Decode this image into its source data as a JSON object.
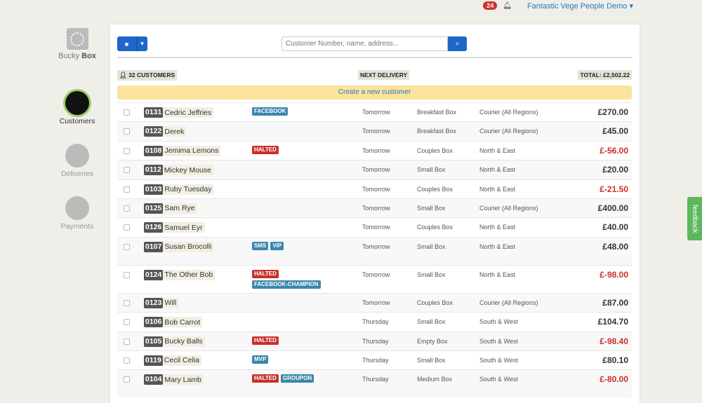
{
  "topbar": {
    "notifications": "24",
    "account": "Fantastic Vege People Demo ▾"
  },
  "sidebar": {
    "logo": {
      "a": "Bucky",
      "b": "Box"
    },
    "items": [
      {
        "label": "Customers"
      },
      {
        "label": "Deliveries"
      },
      {
        "label": "Payments"
      }
    ]
  },
  "toolbar": {
    "dropdown": "▾",
    "search_placeholder": "Customer Number, name, address...",
    "search_icon": "⌕"
  },
  "summary": {
    "customers": "32 CUSTOMERS",
    "next_delivery": "NEXT DELIVERY",
    "total": "TOTAL: £2,502.22"
  },
  "create_label": "Create a new customer",
  "feedback": "feedback",
  "customers": [
    {
      "num": "0131",
      "name": "Cedric Jeffries",
      "tags": [
        "FACEBOOK"
      ],
      "delivery": "Tomorrow",
      "box": "Breakfast Box",
      "route": "Courier (All Regions)",
      "amount": "£270.00"
    },
    {
      "num": "0122",
      "name": "Derek",
      "tags": [],
      "delivery": "Tomorrow",
      "box": "Breakfast Box",
      "route": "Courier (All Regions)",
      "amount": "£45.00"
    },
    {
      "num": "0108",
      "name": "Jemima Lemons",
      "tags": [
        "HALTED"
      ],
      "delivery": "Tomorrow",
      "box": "Couples Box",
      "route": "North & East",
      "amount": "£-56.00"
    },
    {
      "num": "0112",
      "name": "Mickey Mouse",
      "tags": [],
      "delivery": "Tomorrow",
      "box": "Small Box",
      "route": "North & East",
      "amount": "£20.00"
    },
    {
      "num": "0103",
      "name": "Ruby Tuesday",
      "tags": [],
      "delivery": "Tomorrow",
      "box": "Couples Box",
      "route": "North & East",
      "amount": "£-21.50"
    },
    {
      "num": "0125",
      "name": "Sam Rye",
      "tags": [],
      "delivery": "Tomorrow",
      "box": "Small Box",
      "route": "Courier (All Regions)",
      "amount": "£400.00"
    },
    {
      "num": "0126",
      "name": "Samuel Eyr",
      "tags": [],
      "delivery": "Tomorrow",
      "box": "Couples Box",
      "route": "North & East",
      "amount": "£40.00"
    },
    {
      "num": "0107",
      "name": "Susan Brocolli",
      "tags": [
        "SMS",
        "VIP"
      ],
      "delivery": "Tomorrow",
      "box": "Small Box",
      "route": "North & East",
      "amount": "£48.00"
    },
    {
      "num": "0124",
      "name": "The Other Bob",
      "tags": [
        "HALTED",
        "FACEBOOK-CHAMPION"
      ],
      "delivery": "Tomorrow",
      "box": "Small Box",
      "route": "North & East",
      "amount": "£-98.00"
    },
    {
      "num": "0123",
      "name": "Will",
      "tags": [],
      "delivery": "Tomorrow",
      "box": "Couples Box",
      "route": "Courier (All Regions)",
      "amount": "£87.00"
    },
    {
      "num": "0106",
      "name": "Bob Carrot",
      "tags": [],
      "delivery": "Thursday",
      "box": "Small Box",
      "route": "South & West",
      "amount": "£104.70"
    },
    {
      "num": "0105",
      "name": "Bucky Balls",
      "tags": [
        "HALTED"
      ],
      "delivery": "Thursday",
      "box": "Empty Box",
      "route": "South & West",
      "amount": "£-98.40"
    },
    {
      "num": "0119",
      "name": "Cecil Celia",
      "tags": [
        "MVP"
      ],
      "delivery": "Thursday",
      "box": "Small Box",
      "route": "South & West",
      "amount": "£80.10"
    },
    {
      "num": "0104",
      "name": "Mary Lamb",
      "tags": [
        "HALTED",
        "GROUPON"
      ],
      "delivery": "Thursday",
      "box": "Medium Box",
      "route": "South & West",
      "amount": "£-80.00"
    }
  ]
}
